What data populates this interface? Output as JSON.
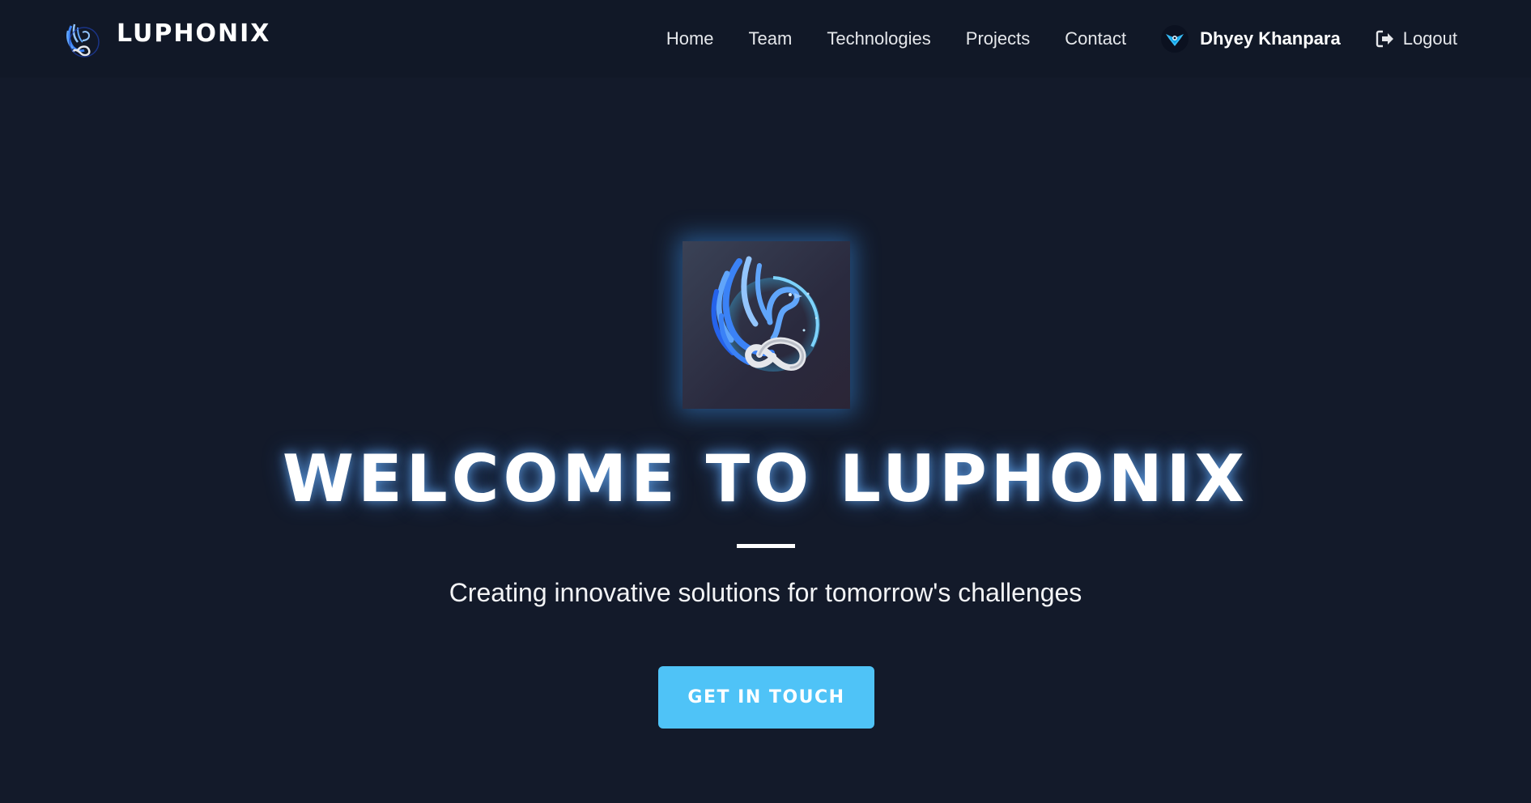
{
  "header": {
    "brand_name": "LUPHONIX",
    "brand_logo_icon": "phoenix-infinity-logo-icon",
    "nav": [
      {
        "label": "Home"
      },
      {
        "label": "Team"
      },
      {
        "label": "Technologies"
      },
      {
        "label": "Projects"
      },
      {
        "label": "Contact"
      }
    ],
    "user": {
      "name": "Dhyey Khanpara",
      "avatar_icon": "user-avatar-icon"
    },
    "logout": {
      "label": "Logout",
      "icon": "logout-icon"
    }
  },
  "hero": {
    "logo_icon": "phoenix-infinity-logo-icon",
    "title": "WELCOME TO LUPHONIX",
    "subtitle": "Creating innovative solutions for tomorrow's challenges",
    "cta_label": "GET IN TOUCH"
  },
  "colors": {
    "background": "#131a2a",
    "header_background": "#111827",
    "accent": "#4fc3f7",
    "glow": "#40a0ff"
  }
}
